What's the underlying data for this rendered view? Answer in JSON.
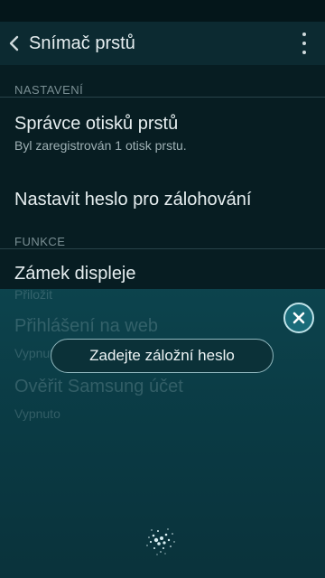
{
  "header": {
    "title": "Snímač prstů"
  },
  "sections": {
    "settings": {
      "label": "NASTAVENÍ"
    },
    "functions": {
      "label": "FUNKCE"
    }
  },
  "items": {
    "fingerprint_manager": {
      "title": "Správce otisků prstů",
      "subtitle": "Byl zaregistrován 1 otisk prstu."
    },
    "backup_password": {
      "title": "Nastavit heslo pro zálohování"
    },
    "screen_lock": {
      "title": "Zámek displeje",
      "subtitle": "Přiložit"
    },
    "web_signin": {
      "title": "Přihlášení na web",
      "subtitle": "Vypnuto"
    },
    "samsung_account": {
      "title": "Ověřit Samsung účet",
      "subtitle": "Vypnuto"
    }
  },
  "dialog": {
    "enter_backup_password": "Zadejte záložní heslo"
  },
  "icons": {
    "back": "chevron-left-icon",
    "more": "more-vert-icon",
    "close": "close-icon",
    "fingerprint": "fingerprint-sparkle-icon"
  }
}
